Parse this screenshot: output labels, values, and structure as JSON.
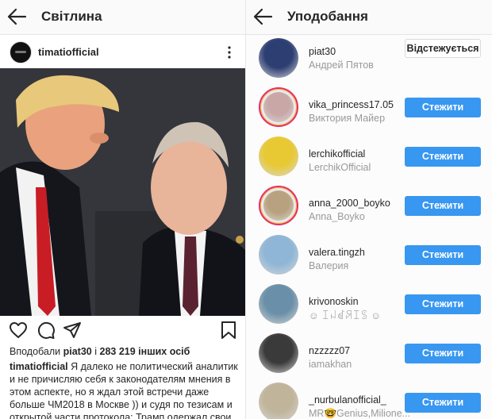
{
  "left": {
    "header": {
      "title": "Світлина"
    },
    "post": {
      "username": "timatiofficial",
      "likes": {
        "prefix": "Вподобали",
        "user": "piat30",
        "connector": "і",
        "count": "283 219 інших осіб"
      },
      "caption": {
        "username": "timatiofficial",
        "text": "Я далеко не политический аналитик и не причисляю себя к законодателям мнения в этом аспекте, но я ждал этой встречи даже больше ЧМ2018 в Москве )) и судя по тезисам и открытой части протокола: Трамп одержал свои"
      }
    }
  },
  "right": {
    "header": {
      "title": "Уподобання"
    },
    "likes": [
      {
        "username": "piat30",
        "fullname": "Андрей Пятов",
        "button": "Відстежується",
        "following": true,
        "story": false,
        "color": "#2d3e73"
      },
      {
        "username": "vika_princess17.05",
        "fullname": "Виктория Майер",
        "button": "Стежити",
        "following": false,
        "story": true,
        "color": "#c9a7a7"
      },
      {
        "username": "lerchikofficial",
        "fullname": "LerchikOfficial",
        "button": "Стежити",
        "following": false,
        "story": false,
        "color": "#e8c933"
      },
      {
        "username": "anna_2000_boyko",
        "fullname": "Anna_Boyko",
        "button": "Стежити",
        "following": false,
        "story": true,
        "color": "#b8a17e"
      },
      {
        "username": "valera.tingzh",
        "fullname": "Валерия",
        "button": "Стежити",
        "following": false,
        "story": false,
        "color": "#8fb6d6"
      },
      {
        "username": "krivonoskin",
        "fullname": "☺ ꀤꈤꀸꋪꀤꌗ ☺",
        "button": "Стежити",
        "following": false,
        "story": false,
        "color": "#6a8fa8"
      },
      {
        "username": "nzzzzz07",
        "fullname": "iamakhan",
        "button": "Стежити",
        "following": false,
        "story": false,
        "color": "#3a3a3a"
      },
      {
        "username": "_nurbulanofficial_",
        "fullname": "MR🤓Genius,Milione...",
        "button": "Стежити",
        "following": false,
        "story": false,
        "color": "#c0b59a"
      }
    ]
  }
}
